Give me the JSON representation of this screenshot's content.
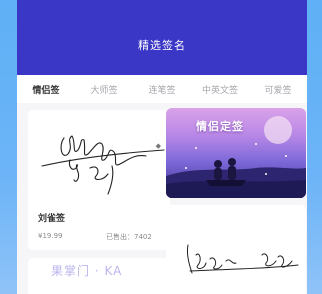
{
  "header": {
    "title": "精选签名"
  },
  "tabs": [
    {
      "label": "情侣签"
    },
    {
      "label": "大师签"
    },
    {
      "label": "连笔签"
    },
    {
      "label": "中英文签"
    },
    {
      "label": "可爱签"
    }
  ],
  "cards": [
    {
      "name": "刘雀签",
      "price": "¥19.99",
      "sold": "已售出：7402"
    }
  ],
  "banner": {
    "title": "情侣定签"
  },
  "watermark": "果掌门 · KA",
  "colors": {
    "header": "#3a36c6",
    "background": "#5fb0f6"
  }
}
